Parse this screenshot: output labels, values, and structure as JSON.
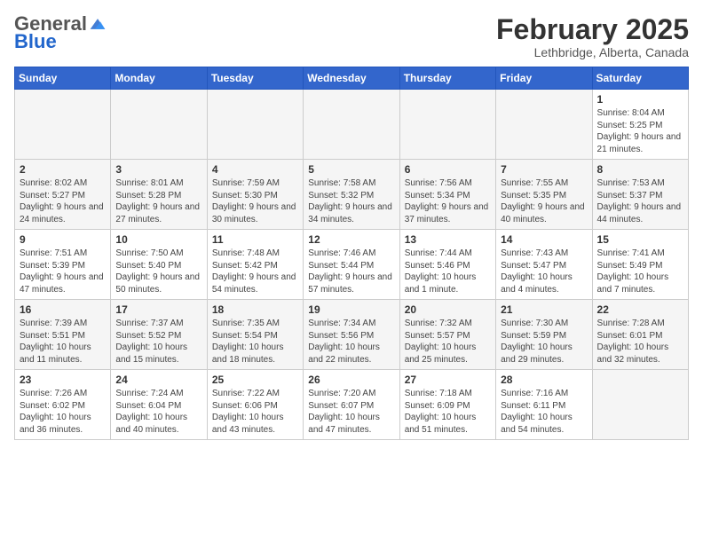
{
  "header": {
    "logo": {
      "general": "General",
      "blue": "Blue"
    },
    "month": "February 2025",
    "location": "Lethbridge, Alberta, Canada"
  },
  "weekdays": [
    "Sunday",
    "Monday",
    "Tuesday",
    "Wednesday",
    "Thursday",
    "Friday",
    "Saturday"
  ],
  "weeks": [
    [
      {
        "day": "",
        "info": ""
      },
      {
        "day": "",
        "info": ""
      },
      {
        "day": "",
        "info": ""
      },
      {
        "day": "",
        "info": ""
      },
      {
        "day": "",
        "info": ""
      },
      {
        "day": "",
        "info": ""
      },
      {
        "day": "1",
        "info": "Sunrise: 8:04 AM\nSunset: 5:25 PM\nDaylight: 9 hours and 21 minutes."
      }
    ],
    [
      {
        "day": "2",
        "info": "Sunrise: 8:02 AM\nSunset: 5:27 PM\nDaylight: 9 hours and 24 minutes."
      },
      {
        "day": "3",
        "info": "Sunrise: 8:01 AM\nSunset: 5:28 PM\nDaylight: 9 hours and 27 minutes."
      },
      {
        "day": "4",
        "info": "Sunrise: 7:59 AM\nSunset: 5:30 PM\nDaylight: 9 hours and 30 minutes."
      },
      {
        "day": "5",
        "info": "Sunrise: 7:58 AM\nSunset: 5:32 PM\nDaylight: 9 hours and 34 minutes."
      },
      {
        "day": "6",
        "info": "Sunrise: 7:56 AM\nSunset: 5:34 PM\nDaylight: 9 hours and 37 minutes."
      },
      {
        "day": "7",
        "info": "Sunrise: 7:55 AM\nSunset: 5:35 PM\nDaylight: 9 hours and 40 minutes."
      },
      {
        "day": "8",
        "info": "Sunrise: 7:53 AM\nSunset: 5:37 PM\nDaylight: 9 hours and 44 minutes."
      }
    ],
    [
      {
        "day": "9",
        "info": "Sunrise: 7:51 AM\nSunset: 5:39 PM\nDaylight: 9 hours and 47 minutes."
      },
      {
        "day": "10",
        "info": "Sunrise: 7:50 AM\nSunset: 5:40 PM\nDaylight: 9 hours and 50 minutes."
      },
      {
        "day": "11",
        "info": "Sunrise: 7:48 AM\nSunset: 5:42 PM\nDaylight: 9 hours and 54 minutes."
      },
      {
        "day": "12",
        "info": "Sunrise: 7:46 AM\nSunset: 5:44 PM\nDaylight: 9 hours and 57 minutes."
      },
      {
        "day": "13",
        "info": "Sunrise: 7:44 AM\nSunset: 5:46 PM\nDaylight: 10 hours and 1 minute."
      },
      {
        "day": "14",
        "info": "Sunrise: 7:43 AM\nSunset: 5:47 PM\nDaylight: 10 hours and 4 minutes."
      },
      {
        "day": "15",
        "info": "Sunrise: 7:41 AM\nSunset: 5:49 PM\nDaylight: 10 hours and 7 minutes."
      }
    ],
    [
      {
        "day": "16",
        "info": "Sunrise: 7:39 AM\nSunset: 5:51 PM\nDaylight: 10 hours and 11 minutes."
      },
      {
        "day": "17",
        "info": "Sunrise: 7:37 AM\nSunset: 5:52 PM\nDaylight: 10 hours and 15 minutes."
      },
      {
        "day": "18",
        "info": "Sunrise: 7:35 AM\nSunset: 5:54 PM\nDaylight: 10 hours and 18 minutes."
      },
      {
        "day": "19",
        "info": "Sunrise: 7:34 AM\nSunset: 5:56 PM\nDaylight: 10 hours and 22 minutes."
      },
      {
        "day": "20",
        "info": "Sunrise: 7:32 AM\nSunset: 5:57 PM\nDaylight: 10 hours and 25 minutes."
      },
      {
        "day": "21",
        "info": "Sunrise: 7:30 AM\nSunset: 5:59 PM\nDaylight: 10 hours and 29 minutes."
      },
      {
        "day": "22",
        "info": "Sunrise: 7:28 AM\nSunset: 6:01 PM\nDaylight: 10 hours and 32 minutes."
      }
    ],
    [
      {
        "day": "23",
        "info": "Sunrise: 7:26 AM\nSunset: 6:02 PM\nDaylight: 10 hours and 36 minutes."
      },
      {
        "day": "24",
        "info": "Sunrise: 7:24 AM\nSunset: 6:04 PM\nDaylight: 10 hours and 40 minutes."
      },
      {
        "day": "25",
        "info": "Sunrise: 7:22 AM\nSunset: 6:06 PM\nDaylight: 10 hours and 43 minutes."
      },
      {
        "day": "26",
        "info": "Sunrise: 7:20 AM\nSunset: 6:07 PM\nDaylight: 10 hours and 47 minutes."
      },
      {
        "day": "27",
        "info": "Sunrise: 7:18 AM\nSunset: 6:09 PM\nDaylight: 10 hours and 51 minutes."
      },
      {
        "day": "28",
        "info": "Sunrise: 7:16 AM\nSunset: 6:11 PM\nDaylight: 10 hours and 54 minutes."
      },
      {
        "day": "",
        "info": ""
      }
    ]
  ]
}
